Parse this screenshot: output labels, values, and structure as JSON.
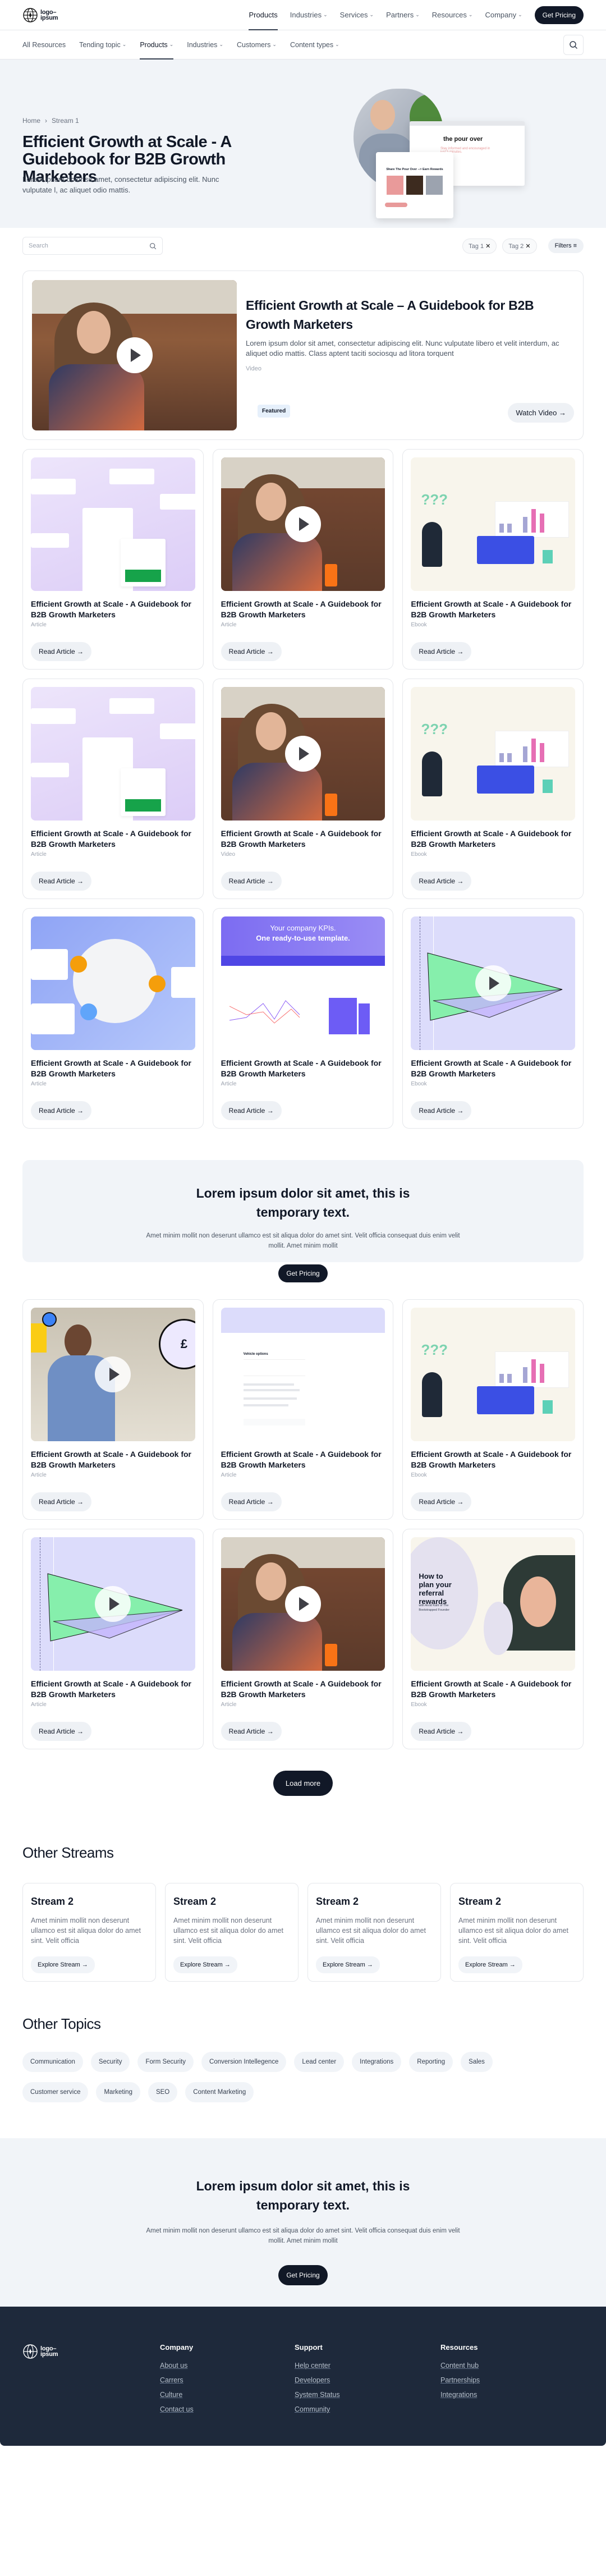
{
  "nav": {
    "logo_line1": "logo–",
    "logo_line2": "ipsum",
    "items": [
      {
        "label": "Products",
        "dropdown": false,
        "active": true
      },
      {
        "label": "Industries",
        "dropdown": true
      },
      {
        "label": "Services",
        "dropdown": true
      },
      {
        "label": "Partners",
        "dropdown": true
      },
      {
        "label": "Resources",
        "dropdown": true
      },
      {
        "label": "Company",
        "dropdown": true
      }
    ],
    "cta": "Get Pricing"
  },
  "subnav": {
    "items": [
      {
        "label": "All Resources",
        "dropdown": false
      },
      {
        "label": "Tending topic",
        "dropdown": true
      },
      {
        "label": "Products",
        "dropdown": true,
        "active": true
      },
      {
        "label": "Industries",
        "dropdown": true
      },
      {
        "label": "Customers",
        "dropdown": true
      },
      {
        "label": "Content types",
        "dropdown": true
      }
    ],
    "search_icon": "search-icon"
  },
  "hero": {
    "breadcrumb": [
      "Home",
      "Stream 1"
    ],
    "title": "Efficient Growth at Scale - A Guidebook for B2B Growth Marketers",
    "description": "Lorem ipsum dolor sit amet, consectetur adipiscing elit. Nunc vulputate l, ac aliquet odio mattis.",
    "art": {
      "brand": "the pour over",
      "tagline": "Stay informed and encouraged in just 5 minutes.",
      "share_title": "Share The Pour Over --> Earn Rewards"
    }
  },
  "filters": {
    "search_placeholder": "Search",
    "tags": [
      "Tag 1",
      "Tag 2"
    ],
    "filters_label": "Filters"
  },
  "featured": {
    "title": "Efficient Growth at Scale – A Guidebook for B2B Growth Marketers",
    "description": "Lorem ipsum dolor sit amet, consectetur adipiscing elit. Nunc vulputate libero et velit interdum, ac aliquet odio mattis. Class aptent taciti sociosqu ad litora torquent",
    "type": "Video",
    "badge": "Featured",
    "button": "Watch Video"
  },
  "card_title": "Efficient Growth at Scale - A Guidebook for B2B Growth Marketers",
  "card_button": "Read Article",
  "grid1": [
    {
      "type": "Article",
      "image": "partner-payouts",
      "play": false
    },
    {
      "type": "Article",
      "image": "woman-cafe",
      "play": true
    },
    {
      "type": "Ebook",
      "image": "referral-chart",
      "play": false
    },
    {
      "type": "Article",
      "image": "partner-payouts",
      "play": false
    },
    {
      "type": "Video",
      "image": "woman-cafe",
      "play": true
    },
    {
      "type": "Ebook",
      "image": "referral-chart",
      "play": false
    },
    {
      "type": "Article",
      "image": "globe-network",
      "play": false
    },
    {
      "type": "Article",
      "image": "kpi-template",
      "play": false,
      "kpi_line1": "Your company KPIs.",
      "kpi_line2": "One ready-to-use template."
    },
    {
      "type": "Ebook",
      "image": "paper-plane",
      "play": true
    }
  ],
  "cta1": {
    "title": "Lorem ipsum dolor sit amet, this is temporary text.",
    "description": "Amet minim mollit non deserunt ullamco est sit aliqua dolor do amet sint. Velit officia consequat duis enim velit mollit. Amet minim mollit",
    "button": "Get Pricing"
  },
  "grid2": [
    {
      "type": "Article",
      "image": "man-phone",
      "play": true
    },
    {
      "type": "Article",
      "image": "vehicle-doc",
      "play": false
    },
    {
      "type": "Ebook",
      "image": "referral-chart",
      "play": false
    },
    {
      "type": "Article",
      "image": "paper-plane",
      "play": true
    },
    {
      "type": "Article",
      "image": "woman-cafe",
      "play": true
    },
    {
      "type": "Ebook",
      "image": "referral-podcast",
      "play": false,
      "podcast_title": "How to plan your referral rewards",
      "podcast_sub": "with Arvid Kahl of The Bootstrapped Founder"
    }
  ],
  "load_more": "Load more",
  "other_streams": {
    "title": "Other Streams",
    "items": [
      {
        "title": "Stream 2",
        "description": "Amet minim mollit non deserunt ullamco est sit aliqua dolor do amet sint. Velit officia",
        "button": "Explore Stream"
      },
      {
        "title": "Stream 2",
        "description": "Amet minim mollit non deserunt ullamco est sit aliqua dolor do amet sint. Velit officia",
        "button": "Explore Stream"
      },
      {
        "title": "Stream 2",
        "description": "Amet minim mollit non deserunt ullamco est sit aliqua dolor do amet sint. Velit officia",
        "button": "Explore Stream"
      },
      {
        "title": "Stream 2",
        "description": "Amet minim mollit non deserunt ullamco est sit aliqua dolor do amet sint. Velit officia",
        "button": "Explore Stream"
      }
    ]
  },
  "other_topics": {
    "title": "Other Topics",
    "items": [
      "Communication",
      "Security",
      "Form Security",
      "Conversion Intellegence",
      "Lead center",
      "Integrations",
      "Reporting",
      "Sales",
      "Customer service",
      "Marketing",
      "SEO",
      "Content Marketing"
    ]
  },
  "cta2": {
    "title": "Lorem ipsum dolor sit amet, this is temporary text.",
    "description": "Amet minim mollit non deserunt ullamco est sit aliqua dolor do amet sint. Velit officia consequat duis enim velit mollit. Amet minim mollit",
    "button": "Get Pricing"
  },
  "footer": {
    "columns": [
      {
        "title": "Company",
        "links": [
          "About us",
          "Carrers",
          "Culture",
          "Contact us"
        ]
      },
      {
        "title": "Support",
        "links": [
          "Help center",
          "Developers",
          "System Status",
          "Community"
        ]
      },
      {
        "title": "Resources",
        "links": [
          "Content hub",
          "Partnerships",
          "Integrations"
        ]
      }
    ]
  },
  "colors": {
    "dark": "#111827",
    "bg_light": "#f1f4f8",
    "footer": "#1e293b"
  }
}
